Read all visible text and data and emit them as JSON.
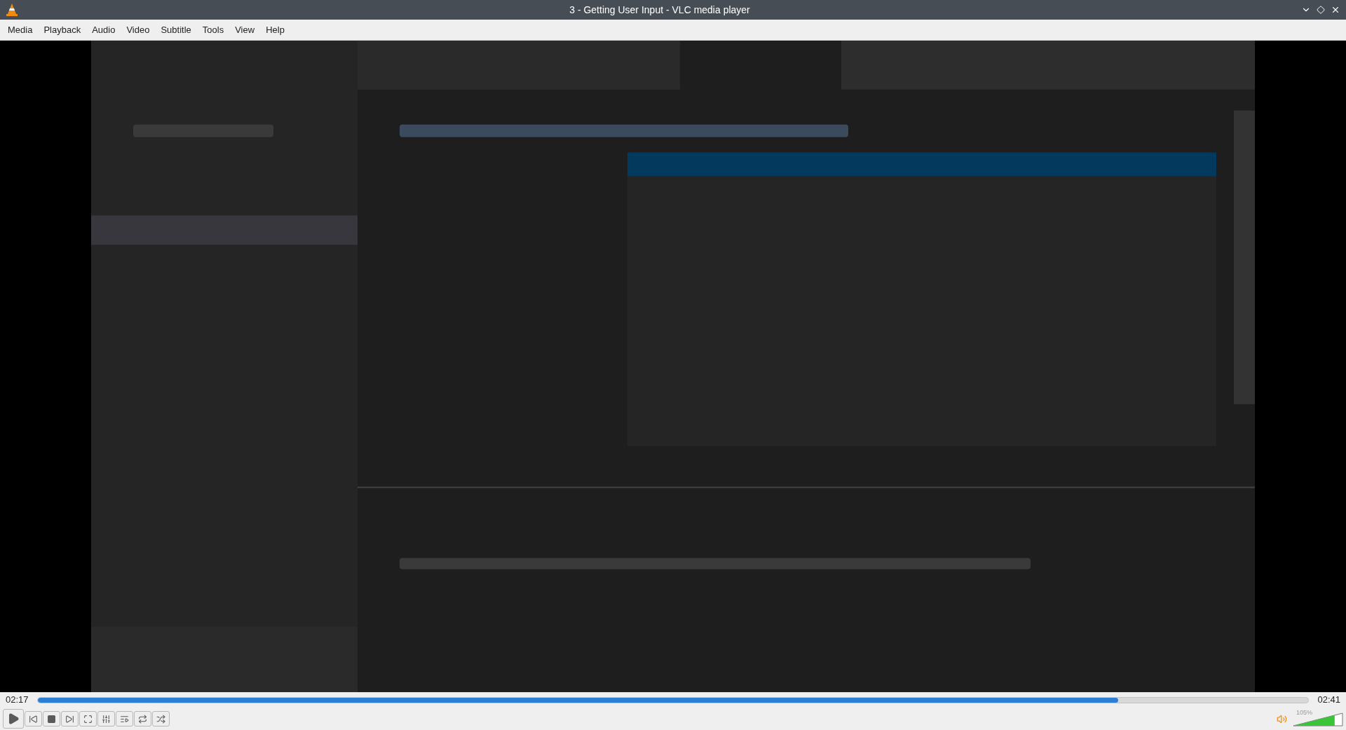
{
  "window": {
    "title": "3 - Getting User Input - VLC media player"
  },
  "menu": [
    "Media",
    "Playback",
    "Audio",
    "Video",
    "Subtitle",
    "Tools",
    "View",
    "Help"
  ],
  "video": {
    "kind": "picture"
  },
  "seek": {
    "elapsed": "02:17",
    "total": "02:41",
    "level": 0.85
  },
  "controls": [
    {
      "kind": "play"
    },
    {
      "kind": "previous"
    },
    {
      "kind": "stop"
    },
    {
      "kind": "next"
    },
    {
      "kind": "fullscreen"
    },
    {
      "kind": "settings"
    },
    {
      "kind": "playlist"
    },
    {
      "kind": "loop"
    },
    {
      "kind": "shuffle"
    }
  ],
  "volume": {
    "reading": "105%",
    "level": 0.84
  }
}
